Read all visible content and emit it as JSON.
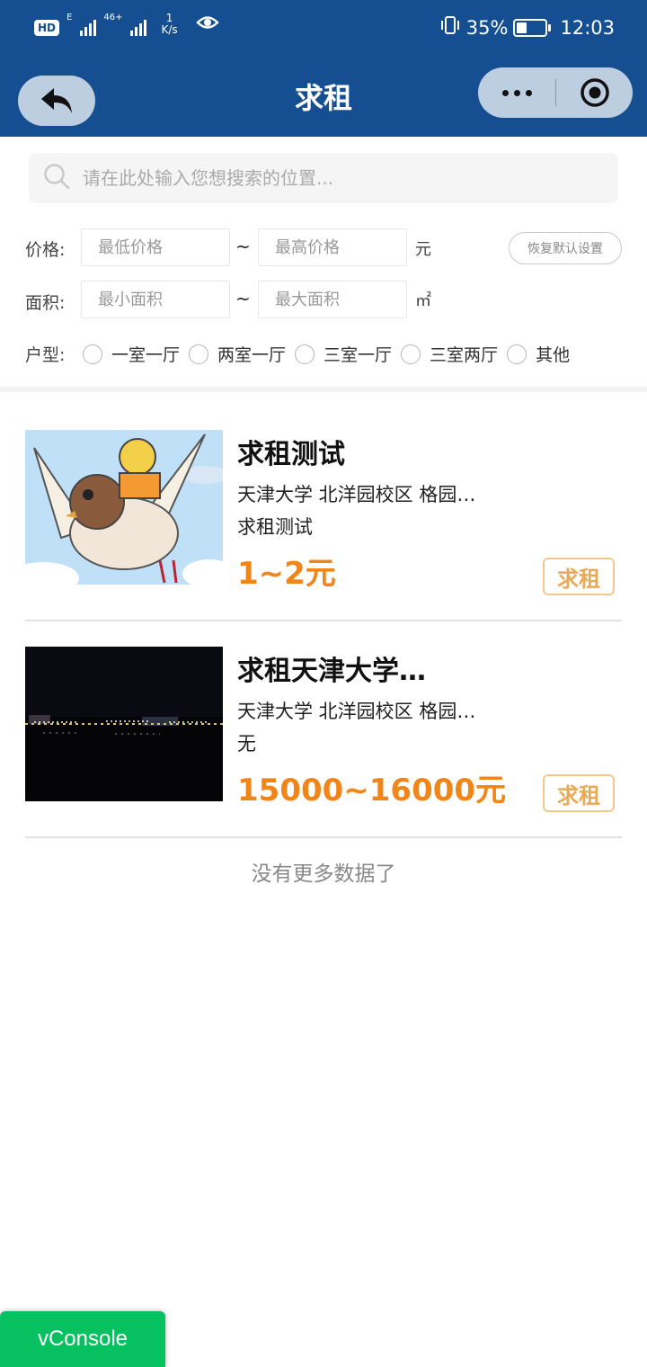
{
  "status_bar": {
    "hd_label": "HD",
    "signal1_label": "E",
    "signal2_label": "46+",
    "speed_value": "1",
    "speed_unit": "K/s",
    "battery_percent": "35%",
    "battery_level": 0.35,
    "time": "12:03"
  },
  "nav": {
    "title": "求租",
    "back_icon": "back-arrow-icon",
    "more_icon": "more-dots-icon",
    "close_icon": "target-circle-icon"
  },
  "search": {
    "placeholder": "请在此处输入您想搜索的位置..."
  },
  "filters": {
    "price_label": "价格:",
    "price_min_placeholder": "最低价格",
    "price_max_placeholder": "最高价格",
    "price_unit": "元",
    "tilde": "~",
    "area_label": "面积:",
    "area_min_placeholder": "最小面积",
    "area_max_placeholder": "最大面积",
    "area_unit": "㎡",
    "reset_label": "恢复默认设置",
    "layout_label": "户型:",
    "layout_options": [
      "一室一厅",
      "两室一厅",
      "三室一厅",
      "三室两厅",
      "其他"
    ]
  },
  "listings": [
    {
      "title": "求租测试",
      "location": "天津大学 北洋园校区 格园…",
      "description": "求租测试",
      "price": "1~2元",
      "tag": "求租"
    },
    {
      "title": "求租天津大学…",
      "location": "天津大学 北洋园校区 格园…",
      "description": "无",
      "price": "15000~16000元",
      "tag": "求租"
    }
  ],
  "footer": {
    "no_more": "没有更多数据了"
  },
  "vconsole": {
    "label": "vConsole"
  },
  "colors": {
    "header_bg": "#154f91",
    "price": "#f08519",
    "tag_border": "#f1c98c",
    "tag_text": "#e9aa55",
    "vconsole_bg": "#07c160"
  }
}
